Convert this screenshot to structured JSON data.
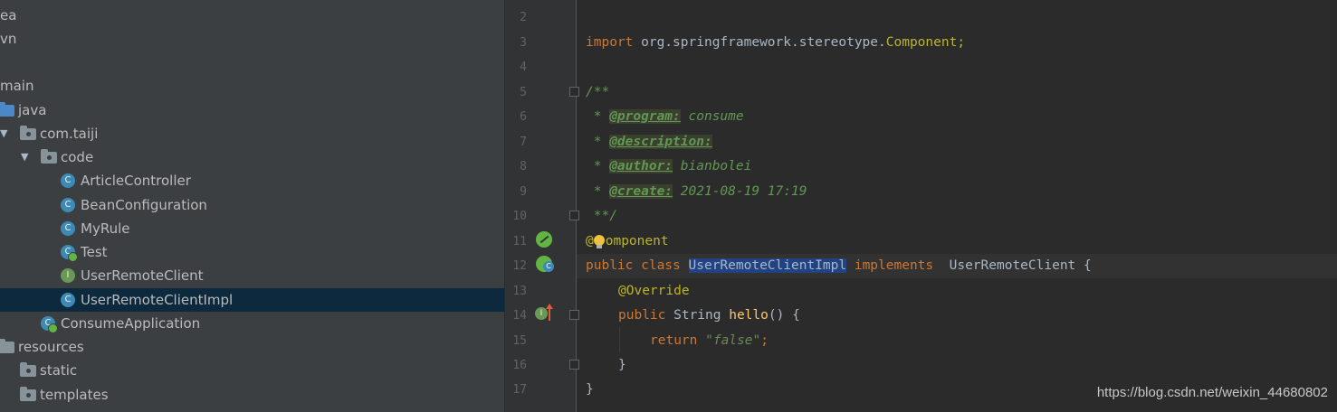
{
  "project_tree": [
    {
      "label": "ea",
      "kind": "text",
      "depth": 0
    },
    {
      "label": "vn",
      "kind": "text",
      "depth": 0
    },
    {
      "label": "",
      "kind": "text",
      "depth": 0
    },
    {
      "label": "main",
      "kind": "text",
      "depth": 0
    },
    {
      "label": "java",
      "kind": "folder-blue",
      "depth": 0
    },
    {
      "label": "com.taiji",
      "kind": "package",
      "depth": 1,
      "expanded": true
    },
    {
      "label": "code",
      "kind": "package",
      "depth": 2,
      "expanded": true
    },
    {
      "label": "ArticleController",
      "kind": "class",
      "icon_letter": "C",
      "depth": 3
    },
    {
      "label": "BeanConfiguration",
      "kind": "class",
      "icon_letter": "C",
      "depth": 3
    },
    {
      "label": "MyRule",
      "kind": "class",
      "icon_letter": "C",
      "depth": 3
    },
    {
      "label": "Test",
      "kind": "class-runnable",
      "icon_letter": "C",
      "depth": 3
    },
    {
      "label": "UserRemoteClient",
      "kind": "interface",
      "icon_letter": "I",
      "depth": 3
    },
    {
      "label": "UserRemoteClientImpl",
      "kind": "class",
      "icon_letter": "C",
      "depth": 3,
      "selected": true
    },
    {
      "label": "ConsumeApplication",
      "kind": "class-spring",
      "icon_letter": "C",
      "depth": 2
    },
    {
      "label": "resources",
      "kind": "folder-res",
      "depth": 0
    },
    {
      "label": "static",
      "kind": "folder",
      "depth": 1
    },
    {
      "label": "templates",
      "kind": "folder",
      "depth": 1
    }
  ],
  "editor": {
    "line_numbers": [
      "2",
      "3",
      "4",
      "5",
      "6",
      "7",
      "8",
      "9",
      "10",
      "11",
      "12",
      "13",
      "14",
      "15",
      "16",
      "17"
    ],
    "import_kw": "import",
    "import_pkg": " org.springframework.stereotype.",
    "import_cls": "Component;",
    "doc_open": "/**",
    "doc_star": " * ",
    "doc_program_tag": "@program:",
    "doc_program_val": " consume",
    "doc_description_tag": "@description:",
    "doc_author_tag": "@author:",
    "doc_author_val": " bianbolei",
    "doc_create_tag": "@create:",
    "doc_create_val": " 2021-08-19 17:19",
    "doc_close": " **/",
    "ann_at": "@",
    "ann_rest": "omponent",
    "cls_public": "public class ",
    "cls_name": "UserRemoteClientImpl",
    "cls_implements": " implements ",
    "cls_iface": " UserRemoteClient {",
    "override": "@Override",
    "m_public": "public ",
    "m_type": "String ",
    "m_name": "hello",
    "m_rest": "() {",
    "ret_kw": "return ",
    "ret_str": "\"false\"",
    "ret_semi": ";",
    "close_inner": "}",
    "close_outer": "}"
  },
  "gutter_icons": {
    "line11": "spring-bean-icon",
    "line12": "spring-class-icon",
    "line14": "implements-method-icon"
  },
  "watermark": "https://blog.csdn.net/weixin_44680802",
  "colors": {
    "panel_bg": "#3c3f41",
    "editor_bg": "#2b2b2b",
    "keyword": "#cc7832",
    "doc_comment": "#629755",
    "selection": "#214283",
    "tree_selected": "#0d293e"
  }
}
